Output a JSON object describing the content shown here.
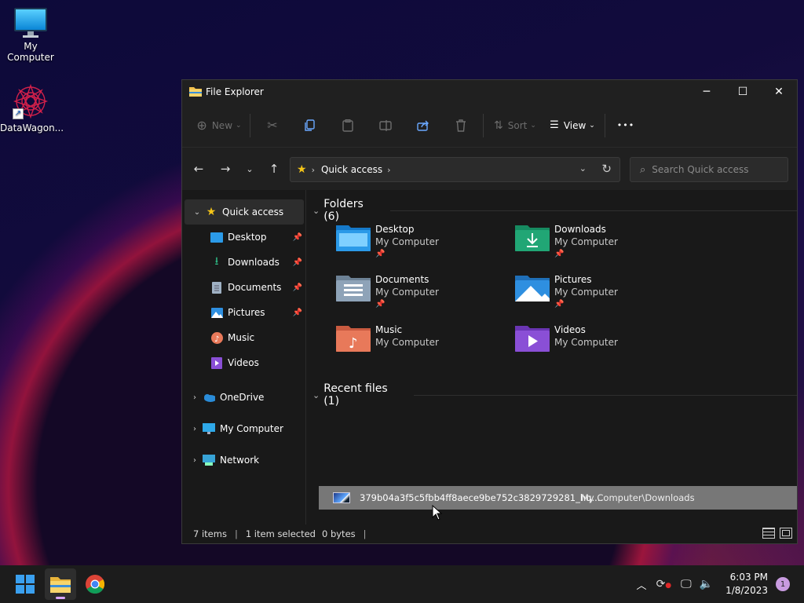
{
  "desktop": {
    "icons": [
      {
        "label": "My Computer",
        "icon": "monitor-icon"
      },
      {
        "label": "DataWagon...",
        "icon": "mandala-shortcut-icon"
      }
    ]
  },
  "window": {
    "title": "File Explorer",
    "controls": {
      "minimize": "─",
      "maximize": "☐",
      "close": "✕"
    }
  },
  "toolbar": {
    "new_label": "New",
    "sort_label": "Sort",
    "view_label": "View",
    "more_label": "•••"
  },
  "nav": {
    "address_crumb": "Quick access",
    "search_placeholder": "Search Quick access"
  },
  "sidebar": {
    "quick_access": "Quick access",
    "items": [
      {
        "label": "Desktop",
        "pinned": true
      },
      {
        "label": "Downloads",
        "pinned": true
      },
      {
        "label": "Documents",
        "pinned": true
      },
      {
        "label": "Pictures",
        "pinned": true
      },
      {
        "label": "Music",
        "pinned": false
      },
      {
        "label": "Videos",
        "pinned": false
      }
    ],
    "roots": [
      {
        "label": "OneDrive"
      },
      {
        "label": "My Computer"
      },
      {
        "label": "Network"
      }
    ]
  },
  "main": {
    "folders_header": "Folders (6)",
    "folders": [
      {
        "name": "Desktop",
        "location": "My Computer",
        "pinned": true,
        "color": "#1e90e8"
      },
      {
        "name": "Downloads",
        "location": "My Computer",
        "pinned": true,
        "color": "#21a675"
      },
      {
        "name": "Documents",
        "location": "My Computer",
        "pinned": true,
        "color": "#8ea3b8"
      },
      {
        "name": "Pictures",
        "location": "My Computer",
        "pinned": true,
        "color": "#2e8fe0"
      },
      {
        "name": "Music",
        "location": "My Computer",
        "pinned": false,
        "color": "#e8795a"
      },
      {
        "name": "Videos",
        "location": "My Computer",
        "pinned": false,
        "color": "#8a4fd6"
      }
    ],
    "recent_header": "Recent files (1)",
    "recent": [
      {
        "name": "379b04a3f5c5fbb4ff8aece9be752c3829729281_hq....",
        "location": "My Computer\\Downloads"
      }
    ]
  },
  "status": {
    "items": "7 items",
    "selected": "1 item selected",
    "size": "0 bytes"
  },
  "taskbar": {
    "time": "6:03 PM",
    "date": "1/8/2023",
    "notifications": "1"
  }
}
